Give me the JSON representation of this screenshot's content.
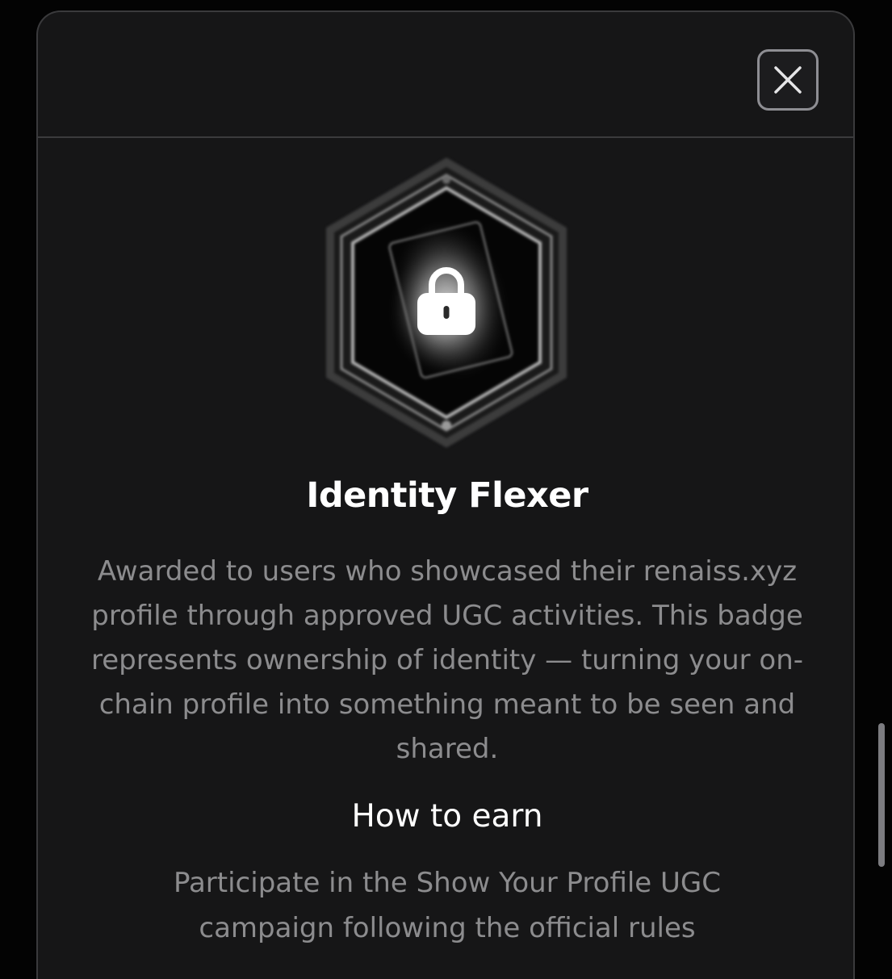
{
  "modal": {
    "close_icon": "close-icon",
    "badge": {
      "name": "Identity Flexer",
      "state_icon": "lock-icon",
      "description": "Awarded to users who showcased their renaiss.xyz profile through approved UGC activities. This badge represents ownership of identity — turning your on-chain profile into something meant to be seen and shared."
    },
    "how_to_earn": {
      "heading": "How to earn",
      "text": "Participate in the Show Your Profile UGC campaign following the official rules"
    }
  },
  "colors": {
    "background": "#030303",
    "modal_surface": "#161617",
    "title_text": "#ffffff",
    "body_text": "#8c8c8e",
    "border": "#3a3a3c"
  }
}
